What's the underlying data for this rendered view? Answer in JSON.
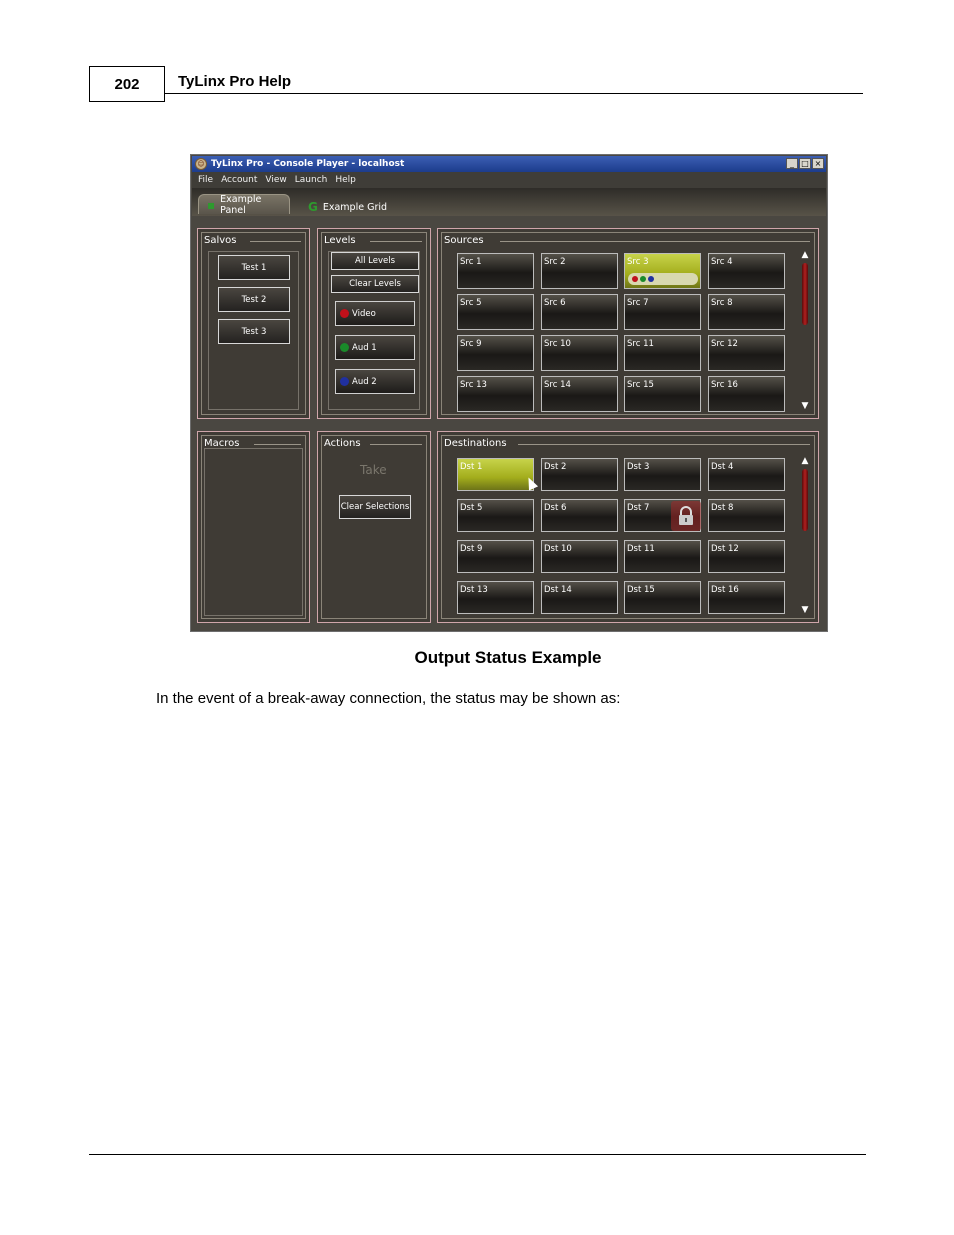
{
  "page": {
    "number": "202",
    "doc_title": "TyLinx Pro Help",
    "caption": "Output Status Example",
    "body_text": "In the event of a break-away connection, the status may be shown as:"
  },
  "app": {
    "window_title": "TyLinx Pro - Console Player - localhost",
    "window_buttons": [
      "_",
      "□",
      "×"
    ],
    "menu": [
      "File",
      "Account",
      "View",
      "Launch",
      "Help"
    ],
    "tabs": [
      {
        "label": "Example Panel",
        "icon": "panel-icon",
        "active": true
      },
      {
        "label": "Example Grid",
        "icon": "grid-g-icon",
        "active": false
      }
    ],
    "salvos": {
      "title": "Salvos",
      "buttons": [
        "Test 1",
        "Test 2",
        "Test 3"
      ]
    },
    "levels": {
      "title": "Levels",
      "all_label": "All Levels",
      "clear_label": "Clear Levels",
      "items": [
        {
          "label": "Video",
          "color": "#c0101a"
        },
        {
          "label": "Aud 1",
          "color": "#1a8a2a"
        },
        {
          "label": "Aud 2",
          "color": "#2030a0"
        }
      ]
    },
    "sources": {
      "title": "Sources",
      "items": [
        "Src 1",
        "Src 2",
        "Src 3",
        "Src 4",
        "Src 5",
        "Src 6",
        "Src 7",
        "Src 8",
        "Src 9",
        "Src 10",
        "Src 11",
        "Src 12",
        "Src 13",
        "Src 14",
        "Src 15",
        "Src 16"
      ],
      "selected": "Src 3"
    },
    "macros": {
      "title": "Macros"
    },
    "actions": {
      "title": "Actions",
      "take_label": "Take",
      "clear_label": "Clear Selections"
    },
    "destinations": {
      "title": "Destinations",
      "items": [
        "Dst 1",
        "Dst 2",
        "Dst 3",
        "Dst 4",
        "Dst 5",
        "Dst 6",
        "Dst 7",
        "Dst 8",
        "Dst 9",
        "Dst 10",
        "Dst 11",
        "Dst 12",
        "Dst 13",
        "Dst 14",
        "Dst 15",
        "Dst 16"
      ],
      "selected": "Dst 1",
      "locked": "Dst 7"
    },
    "colors": {
      "selected": "#b4c02a",
      "panel_bg": "#3f3b35",
      "group_border": "#cfa5aa"
    }
  }
}
